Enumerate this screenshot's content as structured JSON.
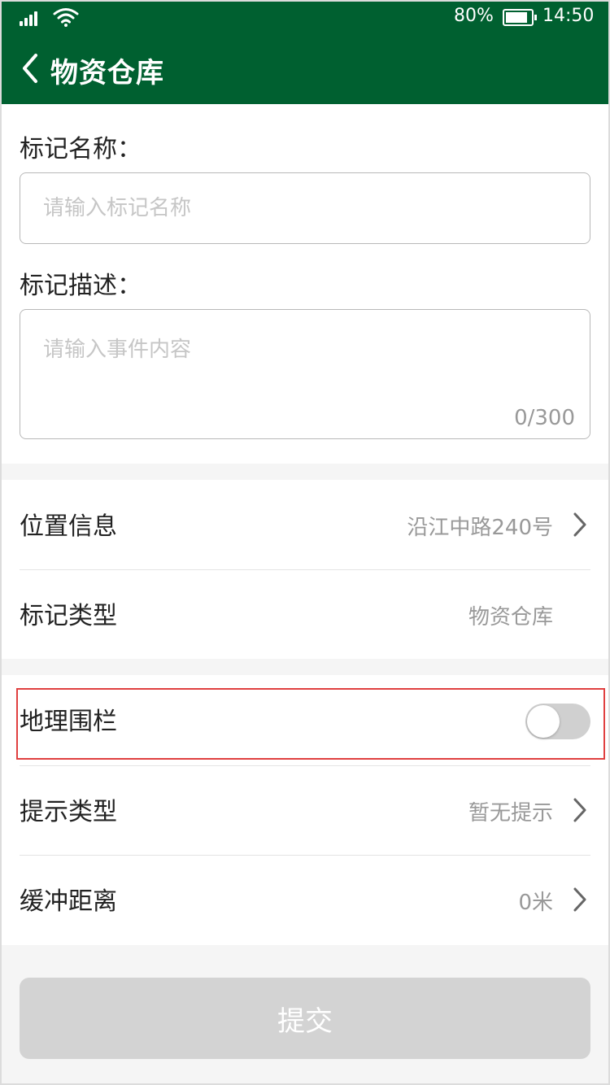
{
  "status_bar": {
    "battery_percent": "80%",
    "time": "14:50"
  },
  "header": {
    "title": "物资仓库",
    "icons": {
      "back": "chevron-left-icon"
    }
  },
  "form": {
    "name_label": "标记名称：",
    "name_placeholder": "请输入标记名称",
    "name_value": "",
    "desc_label": "标记描述：",
    "desc_placeholder": "请输入事件内容",
    "desc_value": "",
    "desc_counter": "0/300"
  },
  "settings": {
    "location": {
      "label": "位置信息",
      "value": "沿江中路240号"
    },
    "mark_type": {
      "label": "标记类型",
      "value": "物资仓库"
    },
    "geofence": {
      "label": "地理围栏",
      "enabled": false
    },
    "prompt_type": {
      "label": "提示类型",
      "value": "暂无提示"
    },
    "buffer_distance": {
      "label": "缓冲距离",
      "value": "0米"
    }
  },
  "submit_label": "提交",
  "colors": {
    "header_bg": "#006030",
    "highlight_border": "#e04040",
    "submit_disabled_bg": "#d3d3d3"
  }
}
